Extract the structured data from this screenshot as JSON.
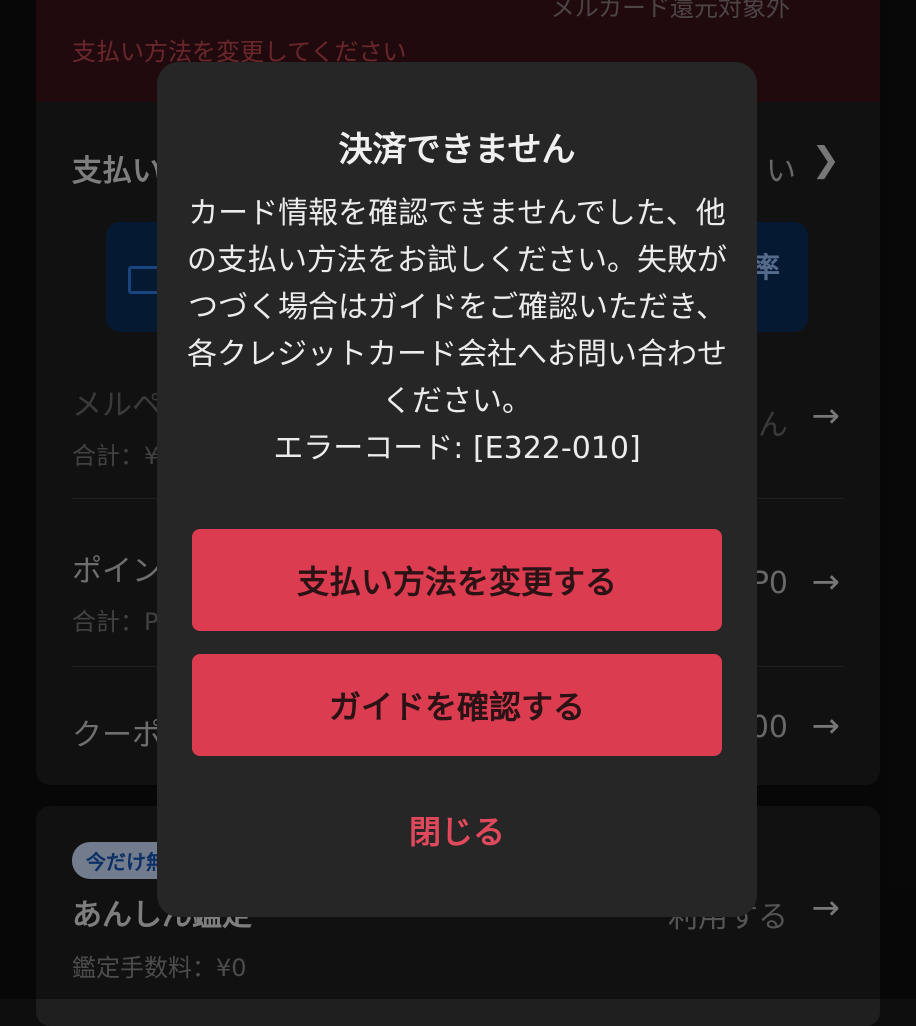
{
  "background": {
    "error_strip_top_text": "メルカード還元対象外",
    "error_strip_message": "支払い方法を変更してください",
    "payment_row": {
      "title": "支払い",
      "right": "い"
    },
    "blue_box": {
      "right": "率"
    },
    "merpay_row": {
      "title": "メルペ",
      "sub": "合計：¥",
      "right": "ん"
    },
    "points_row": {
      "title": "ポイン",
      "sub": "合計：P",
      "right": "P0"
    },
    "coupon_row": {
      "title": "クーポ",
      "right": "00"
    },
    "campaign_badge": "今だけ無",
    "anshin_row": {
      "title": "あんしん鑑定",
      "sub": "鑑定手数料：¥0",
      "right": "利用する"
    }
  },
  "dialog": {
    "title": "決済できません",
    "body": "カード情報を確認できませんでした、他の支払い方法をお試しください。失敗がつづく場合はガイドをご確認いただき、各クレジットカード会社へお問い合わせください。",
    "error_code": "エラーコード: [E322-010]",
    "primary_button": "支払い方法を変更する",
    "secondary_button": "ガイドを確認する",
    "close_link": "閉じる"
  },
  "colors": {
    "accent": "#dc3c50",
    "dialog_bg": "#262626",
    "page_bg": "#0e0e0e"
  },
  "icons": {
    "arrow": "arrow-right-icon",
    "chevron": "chevron-right-icon",
    "card": "credit-card-icon"
  }
}
